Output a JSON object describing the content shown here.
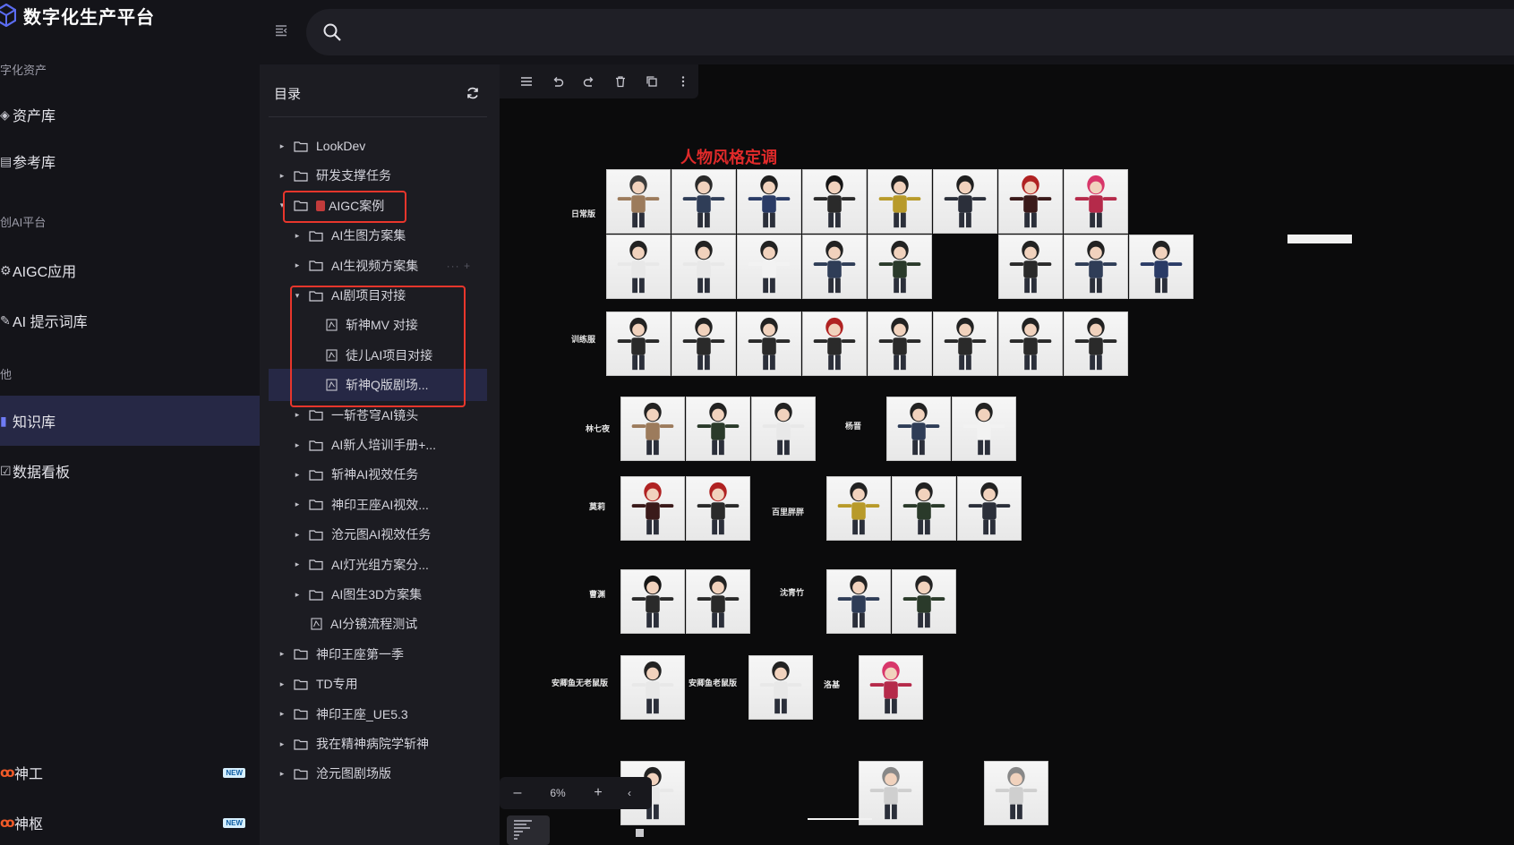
{
  "brand": {
    "title": "数字化生产平台"
  },
  "sidebar": {
    "sections": [
      {
        "label": "字化资产"
      },
      {
        "label": "创AI平台"
      },
      {
        "label": "他"
      }
    ],
    "items": [
      {
        "label": "资产库",
        "icon": "asset-icon"
      },
      {
        "label": "参考库",
        "icon": "reference-icon"
      },
      {
        "label": "AIGC应用",
        "icon": "aigc-icon"
      },
      {
        "label": "AI 提示词库",
        "icon": "prompt-icon"
      },
      {
        "label": "知识库",
        "icon": "knowledge-icon",
        "active": true
      },
      {
        "label": "数据看板",
        "icon": "dashboard-icon"
      }
    ],
    "apps": [
      {
        "label": "神工",
        "badge": "NEW"
      },
      {
        "label": "神枢",
        "badge": "NEW"
      }
    ]
  },
  "search": {
    "placeholder": ""
  },
  "directory": {
    "title": "目录",
    "tree": [
      {
        "label": "LookDev",
        "type": "folder",
        "level": 0,
        "arrow": "▸"
      },
      {
        "label": "研发支撑任务",
        "type": "folder",
        "level": 0,
        "arrow": "▸"
      },
      {
        "label": "AIGC案例",
        "type": "folder",
        "level": 0,
        "arrow": "▾"
      },
      {
        "label": "AI生图方案集",
        "type": "folder",
        "level": 1,
        "arrow": "▸"
      },
      {
        "label": "AI生视频方案集",
        "type": "folder",
        "level": 1,
        "arrow": "▸"
      },
      {
        "label": "AI剧项目对接",
        "type": "folder",
        "level": 1,
        "arrow": "▾"
      },
      {
        "label": "斩神MV 对接",
        "type": "doc",
        "level": 2
      },
      {
        "label": "徒儿AI项目对接",
        "type": "doc",
        "level": 2
      },
      {
        "label": "斩神Q版剧场...",
        "type": "doc",
        "level": 2,
        "selected": true
      },
      {
        "label": "一斩苍穹AI镜头",
        "type": "folder",
        "level": 1,
        "arrow": "▸"
      },
      {
        "label": "AI新人培训手册+...",
        "type": "folder",
        "level": 1,
        "arrow": "▸"
      },
      {
        "label": "斩神AI视效任务",
        "type": "folder",
        "level": 1,
        "arrow": "▸"
      },
      {
        "label": "神印王座AI视效...",
        "type": "folder",
        "level": 1,
        "arrow": "▸"
      },
      {
        "label": "沧元图AI视效任务",
        "type": "folder",
        "level": 1,
        "arrow": "▸"
      },
      {
        "label": "AI灯光组方案分...",
        "type": "folder",
        "level": 1,
        "arrow": "▸"
      },
      {
        "label": "AI图生3D方案集",
        "type": "folder",
        "level": 1,
        "arrow": "▸"
      },
      {
        "label": "AI分镜流程测试",
        "type": "doc",
        "level": 1
      },
      {
        "label": "神印王座第一季",
        "type": "folder",
        "level": 0,
        "arrow": "▸"
      },
      {
        "label": "TD专用",
        "type": "folder",
        "level": 0,
        "arrow": "▸"
      },
      {
        "label": "神印王座_UE5.3",
        "type": "folder",
        "level": 0,
        "arrow": "▸"
      },
      {
        "label": "我在精神病院学斩神",
        "type": "folder",
        "level": 0,
        "arrow": "▸"
      },
      {
        "label": "沧元图剧场版",
        "type": "folder",
        "level": 0,
        "arrow": "▸"
      }
    ]
  },
  "canvas": {
    "board_title": "人物风格定调",
    "row_labels": [
      {
        "text": "日常版"
      },
      {
        "text": "训练服"
      },
      {
        "text": "林七夜"
      },
      {
        "text": "杨晋"
      },
      {
        "text": "莫莉"
      },
      {
        "text": "百里胖胖"
      },
      {
        "text": "曹渊"
      },
      {
        "text": "沈青竹"
      },
      {
        "text": "安卿鱼无老鼠版"
      },
      {
        "text": "安卿鱼老鼠版"
      },
      {
        "text": "洛基"
      }
    ],
    "zoom": "6%",
    "colors": {
      "title_red": "#e02a2a",
      "highlight_red": "#e8362c",
      "active_nav": "#262845",
      "accent": "#6f7cf5"
    }
  }
}
